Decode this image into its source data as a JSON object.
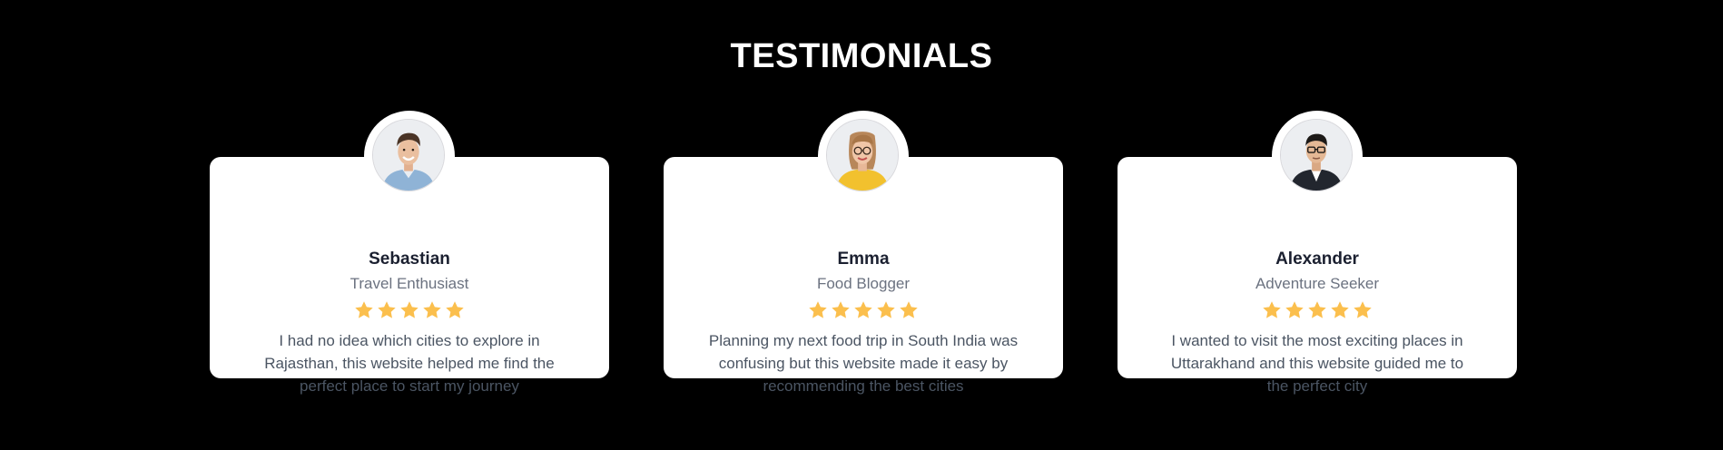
{
  "section": {
    "title": "TESTIMONIALS"
  },
  "colors": {
    "background": "#000000",
    "card": "#ffffff",
    "star": "#fbbf4d",
    "name": "#1b2030",
    "role": "#6b7280",
    "quote": "#4b5563"
  },
  "testimonials": [
    {
      "name": "Sebastian",
      "role": "Travel Enthusiast",
      "rating": 5,
      "quote": "I had no idea which cities to explore in Rajasthan, this website helped me find the perfect place to start my journey",
      "avatar_icon": "man-smiling-blue-shirt-avatar"
    },
    {
      "name": "Emma",
      "role": "Food Blogger",
      "rating": 5,
      "quote": "Planning my next food trip in South India was confusing but this website made it easy by recommending the best cities",
      "avatar_icon": "woman-glasses-yellow-sweater-avatar"
    },
    {
      "name": "Alexander",
      "role": "Adventure Seeker",
      "rating": 5,
      "quote": "I wanted to visit the most exciting places in Uttarakhand and this website guided me to the perfect city",
      "avatar_icon": "man-glasses-dark-suit-avatar"
    }
  ]
}
